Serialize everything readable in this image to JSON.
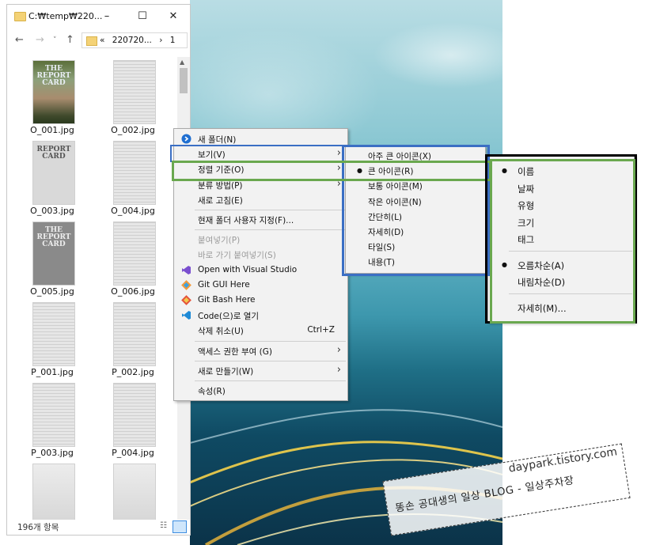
{
  "explorer": {
    "title": "C:₩temp₩220...",
    "address": {
      "prefix": "«",
      "folder": "220720...",
      "sep": "›",
      "current": "1"
    },
    "status": "196개 항목",
    "files": [
      {
        "name": "O_001.jpg",
        "cover": "THE\nREPORT\nCARD"
      },
      {
        "name": "O_002.jpg",
        "cover": ""
      },
      {
        "name": "O_003.jpg",
        "cover": "REPORT\nCARD"
      },
      {
        "name": "O_004.jpg",
        "cover": ""
      },
      {
        "name": "O_005.jpg",
        "cover": "THE\nREPORT\nCARD"
      },
      {
        "name": "O_006.jpg",
        "cover": ""
      },
      {
        "name": "P_001.jpg",
        "cover": ""
      },
      {
        "name": "P_002.jpg",
        "cover": ""
      },
      {
        "name": "P_003.jpg",
        "cover": ""
      },
      {
        "name": "P_004.jpg",
        "cover": ""
      },
      {
        "name": "",
        "cover": ""
      },
      {
        "name": "",
        "cover": ""
      }
    ]
  },
  "context_menu": {
    "items": [
      {
        "label": "새 폴더(N)",
        "icon": "new-folder-icon"
      },
      {
        "label": "보기(V)",
        "submenu": true
      },
      {
        "label": "정렬 기준(O)",
        "submenu": true
      },
      {
        "label": "분류 방법(P)",
        "submenu": true
      },
      {
        "label": "새로 고침(E)"
      },
      {
        "sep": true
      },
      {
        "label": "현재 폴더 사용자 지정(F)..."
      },
      {
        "sep": true
      },
      {
        "label": "붙여넣기(P)",
        "disabled": true
      },
      {
        "label": "바로 가기 붙여넣기(S)",
        "disabled": true
      },
      {
        "label": "Open with Visual Studio",
        "icon": "visual-studio-icon"
      },
      {
        "label": "Git GUI Here",
        "icon": "git-gui-icon"
      },
      {
        "label": "Git Bash Here",
        "icon": "git-bash-icon"
      },
      {
        "label": "Code(으)로 열기",
        "icon": "vscode-icon"
      },
      {
        "label": "삭제 취소(U)",
        "shortcut": "Ctrl+Z"
      },
      {
        "sep": true
      },
      {
        "label": "액세스 권한 부여 (G)",
        "submenu": true
      },
      {
        "sep": true
      },
      {
        "label": "새로 만들기(W)",
        "submenu": true
      },
      {
        "sep": true
      },
      {
        "label": "속성(R)"
      }
    ]
  },
  "view_menu": {
    "items": [
      {
        "label": "아주 큰 아이콘(X)"
      },
      {
        "label": "큰 아이콘(R)",
        "checked": true
      },
      {
        "label": "보통 아이콘(M)"
      },
      {
        "label": "작은 아이콘(N)"
      },
      {
        "label": "간단히(L)"
      },
      {
        "label": "자세히(D)"
      },
      {
        "label": "타일(S)"
      },
      {
        "label": "내용(T)"
      }
    ]
  },
  "sort_menu": {
    "items": [
      {
        "label": "이름",
        "checked": true
      },
      {
        "label": "날짜"
      },
      {
        "label": "유형"
      },
      {
        "label": "크기"
      },
      {
        "label": "태그"
      },
      {
        "sep": true
      },
      {
        "label": "오름차순(A)",
        "checked": true
      },
      {
        "label": "내림차순(D)"
      },
      {
        "sep": true
      },
      {
        "label": "자세히(M)..."
      }
    ]
  },
  "watermark": {
    "url": "daypark.tistory.com",
    "text": "똥손 공대생의 일상 BLOG - 일상주차장"
  },
  "colors": {
    "view_highlight": "#3b6fc4",
    "sort_highlight": "#6aa84f",
    "sort_menu_border": "#000000"
  }
}
